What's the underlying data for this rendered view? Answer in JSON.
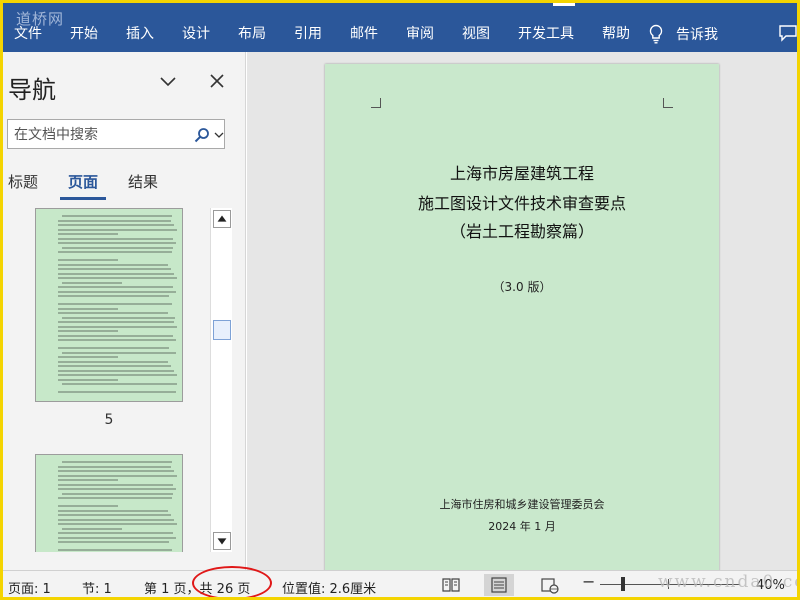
{
  "watermark_top": "道桥网",
  "ribbon": {
    "tabs": [
      "文件",
      "开始",
      "插入",
      "设计",
      "布局",
      "引用",
      "邮件",
      "审阅",
      "视图",
      "开发工具",
      "帮助"
    ],
    "tell_me": "告诉我"
  },
  "nav": {
    "title": "导航",
    "search_placeholder": "在文档中搜索",
    "tabs": [
      "标题",
      "页面",
      "结果"
    ],
    "active_tab": "页面",
    "thumb_page_number": "5"
  },
  "document": {
    "title_lines": [
      "上海市房屋建筑工程",
      "施工图设计文件技术审查要点",
      "（岩土工程勘察篇）"
    ],
    "version": "（3.0 版）",
    "publisher": "上海市住房和城乡建设管理委员会",
    "date": "2024 年 1 月",
    "page_color": "#c9e8cc"
  },
  "status": {
    "page": "页面: 1",
    "section": "节: 1",
    "page_of": "第 1 页，共 26 页",
    "position": "位置值: 2.6厘米",
    "zoom_level": 0.4,
    "zoom_label": "40%"
  },
  "watermark_bottom": "www.cnda0.com",
  "colors": {
    "ribbon": "#2b579a",
    "highlight_circle": "#e01818",
    "frame": "#f4d400"
  }
}
